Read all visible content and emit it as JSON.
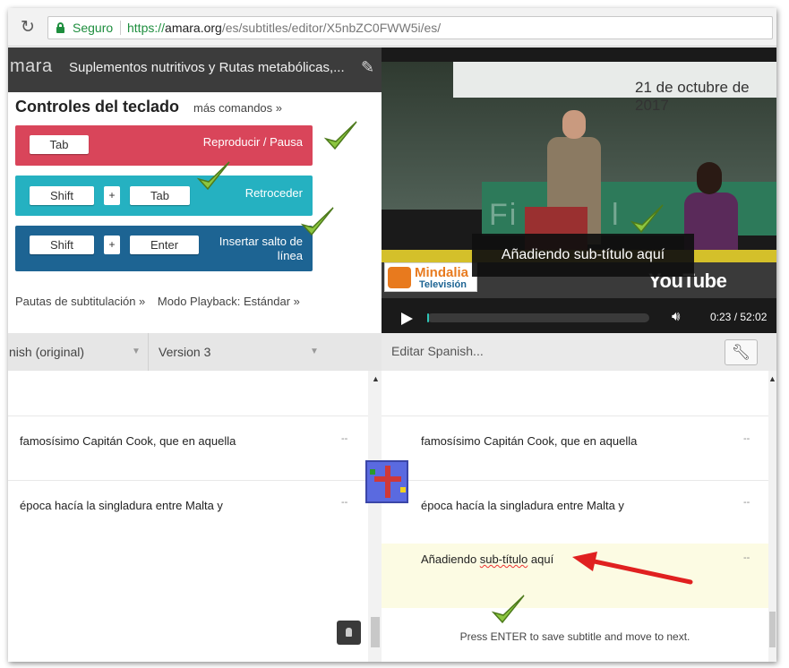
{
  "browser": {
    "secure_label": "Seguro",
    "url_scheme": "https://",
    "url_host": "amara.org",
    "url_path": "/es/subtitles/editor/X5nbZC0FWW5i/es/"
  },
  "header": {
    "logo": "mara",
    "title": "Suplementos nutritivos y Rutas metabólicas,..."
  },
  "keyboard": {
    "title": "Controles del teclado",
    "more_commands": "más comandos »",
    "rows": [
      {
        "keys": [
          "Tab"
        ],
        "action": "Reproducir / Pausa",
        "color": "#d9455a"
      },
      {
        "keys": [
          "Shift",
          "Tab"
        ],
        "action": "Retroceder",
        "color": "#25b1c1"
      },
      {
        "keys": [
          "Shift",
          "Enter"
        ],
        "action": "Insertar salto de línea",
        "color": "#1d6493"
      }
    ],
    "plus": "+",
    "guidelines_link": "Pautas de subtitulación »",
    "playback_mode": "Modo Playback: Estándar »"
  },
  "video": {
    "date_banner": "21 de octubre de 2017",
    "caption": "Añadiendo sub-título aquí",
    "logo_top": "Mindalia",
    "logo_bottom": "Televisión",
    "youtube": "YouTube",
    "time": "0:23 / 52:02",
    "progress": 0.007,
    "accent": "#2ec4b6"
  },
  "left_panel": {
    "col_a": "nish (original)",
    "col_b": "Version 3",
    "rows": [
      {
        "text": "famosísimo Capitán Cook, que en aquella",
        "dash": "--"
      },
      {
        "text": "época hacía la singladura entre Malta y",
        "dash": "--"
      }
    ]
  },
  "right_panel": {
    "header": "Editar Spanish...",
    "rows": [
      {
        "text": "famosísimo Capitán Cook, que en aquella",
        "dash": "--"
      },
      {
        "text": "época hacía la singladura entre Malta y",
        "dash": "--"
      }
    ],
    "active_row": {
      "prefix": "Añadiendo ",
      "misspelled": "sub-título",
      "suffix": " aquí",
      "dash": "--"
    },
    "hint": "Press ENTER to save subtitle and move to next."
  },
  "icons": [
    "reload-icon",
    "lock-icon",
    "pencil-icon",
    "play-icon",
    "volume-icon",
    "wrench-icon",
    "lock-button-icon",
    "checkmark-icon",
    "red-arrow-icon"
  ]
}
